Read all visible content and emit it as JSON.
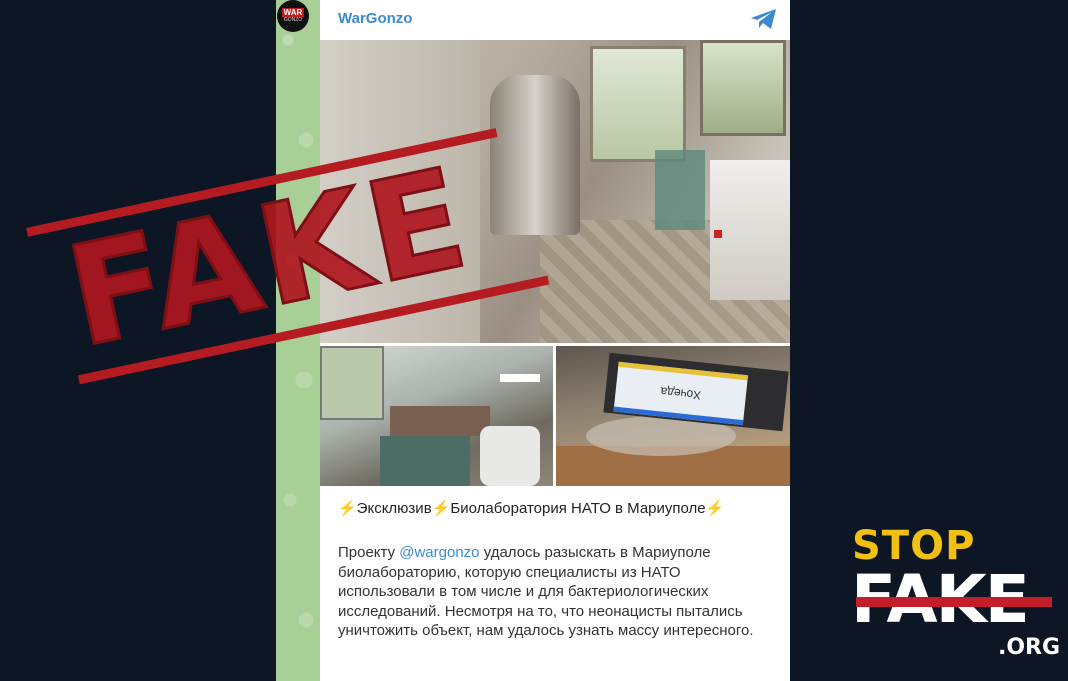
{
  "avatar": {
    "line1": "WAR",
    "line2": "GONZO"
  },
  "post": {
    "channel_name": "WarGonzo",
    "headline_bolt": "⚡",
    "headline_part1": "Эксклюзив",
    "headline_part2": "Биолаборатория НАТО в Мариуполе",
    "body_prefix": "Проекту ",
    "mention": "@wargonzo",
    "body_rest": " удалось разыскать в Мариуполе биолабораторию, которую специалисты из НАТО использовали в том числе и для бактериологических исследований. Несмотря на то, что неонацисты пытались уничтожить объект, нам удалось узнать массу интересного.",
    "photo_label": "Хочеда"
  },
  "stamp": {
    "text": "FAKE"
  },
  "logo": {
    "stop": "STOP",
    "fake": "FAKE",
    "org": ".ORG"
  },
  "colors": {
    "background": "#0c1624",
    "stamp_red": "#b41c22",
    "logo_yellow": "#f2c011",
    "link_blue": "#3b8ad0"
  }
}
